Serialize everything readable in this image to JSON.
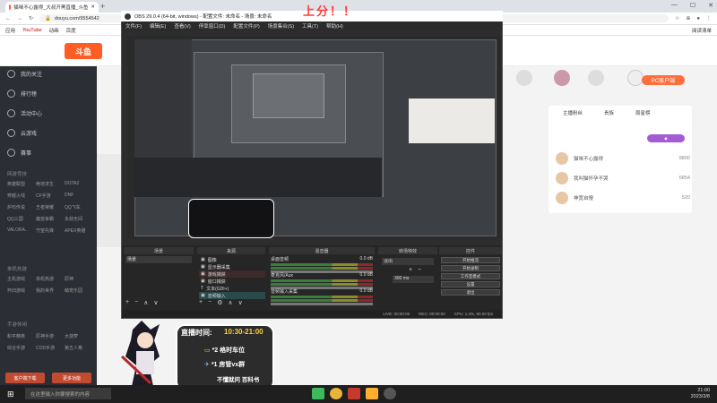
{
  "browser": {
    "tab_title": "猫咪不心露得_大叔开黑直播_斗鱼",
    "address": "douyu.com/9554542",
    "bookmarks": [
      "应用",
      "YouTube",
      "动画",
      "百度"
    ],
    "reading_list": "阅读清单"
  },
  "banner": "上分！！",
  "douyu": {
    "logo": "斗鱼",
    "sidebar": {
      "items": [
        "我的关注",
        "排行榜",
        "活动中心",
        "云游戏",
        "赛事"
      ],
      "section1": "网游竞技",
      "games": [
        "英雄联盟",
        "绝地求生",
        "DOTA2",
        "穿越火线",
        "CF手游",
        "DNF",
        "炉石传说",
        "王者荣耀",
        "QQ飞车",
        "QQ三国",
        "魔兽争霸",
        "永劫无间",
        "VALORA..",
        "守望先锋",
        "APEX英雄"
      ],
      "section2": "单机热游",
      "games2": [
        "主机游戏",
        "单机热游",
        "原神",
        "怀旧游戏",
        "我的世界",
        "萌宠乐园"
      ],
      "section3": "手游休闲",
      "games3": [
        "和平精英",
        "原神手游",
        "大菠萝",
        "综合手游",
        "COD手游",
        "第五人格"
      ],
      "buttons": [
        "客户端下载",
        "更多功能"
      ]
    },
    "pc_button": "PC客户端",
    "rank_tabs": [
      "主播粉丝",
      "贵族",
      "周星榜"
    ],
    "rank_rows": [
      {
        "name": "猫咪不心露得",
        "value": "8800"
      },
      {
        "name": "我叫猫怀孕不哭",
        "value": "6854"
      },
      {
        "name": "神宽自慢",
        "value": "520"
      }
    ]
  },
  "obs": {
    "title": "OBS 29.0.4 (64-bit, windows) - 配置文件: 未命名 - 场景: 未命名",
    "menu": [
      "文件(F)",
      "编辑(E)",
      "查看(V)",
      "停靠窗口(D)",
      "配置文件(P)",
      "场景集合(S)",
      "工具(T)",
      "帮助(H)"
    ],
    "docks": [
      "场景",
      "来源",
      "混音器",
      "转场特效",
      "控件"
    ],
    "scene": "场景",
    "sources": [
      "图像",
      "显示器采集",
      "游戏捕获",
      "窗口捕获",
      "文本(GDI+)",
      "音频输入"
    ],
    "mixer": [
      {
        "name": "桌面音频",
        "db": "0.0 dB"
      },
      {
        "name": "麦克风/Aux",
        "db": "0.0 dB"
      },
      {
        "name": "音频输入采集",
        "db": "0.0 dB"
      }
    ],
    "transition": "淡出",
    "duration": "300 ms",
    "controls": [
      "开始推流",
      "开始录制",
      "工作室模式",
      "设置",
      "退出"
    ],
    "status": [
      "LIVE: 00:00:00",
      "REC: 00:00:00",
      "CPU: 1.3%, 60.00 fps"
    ]
  },
  "overlay": {
    "title": "直播时间:",
    "time": "10:30-21:00",
    "lines": [
      "*2 格时车位",
      "*1 房管vx群",
      "不懂就问 百科书"
    ]
  },
  "taskbar": {
    "search": "在这里输入你要搜索的内容",
    "time": "21:00",
    "date": "2023/3/8"
  }
}
